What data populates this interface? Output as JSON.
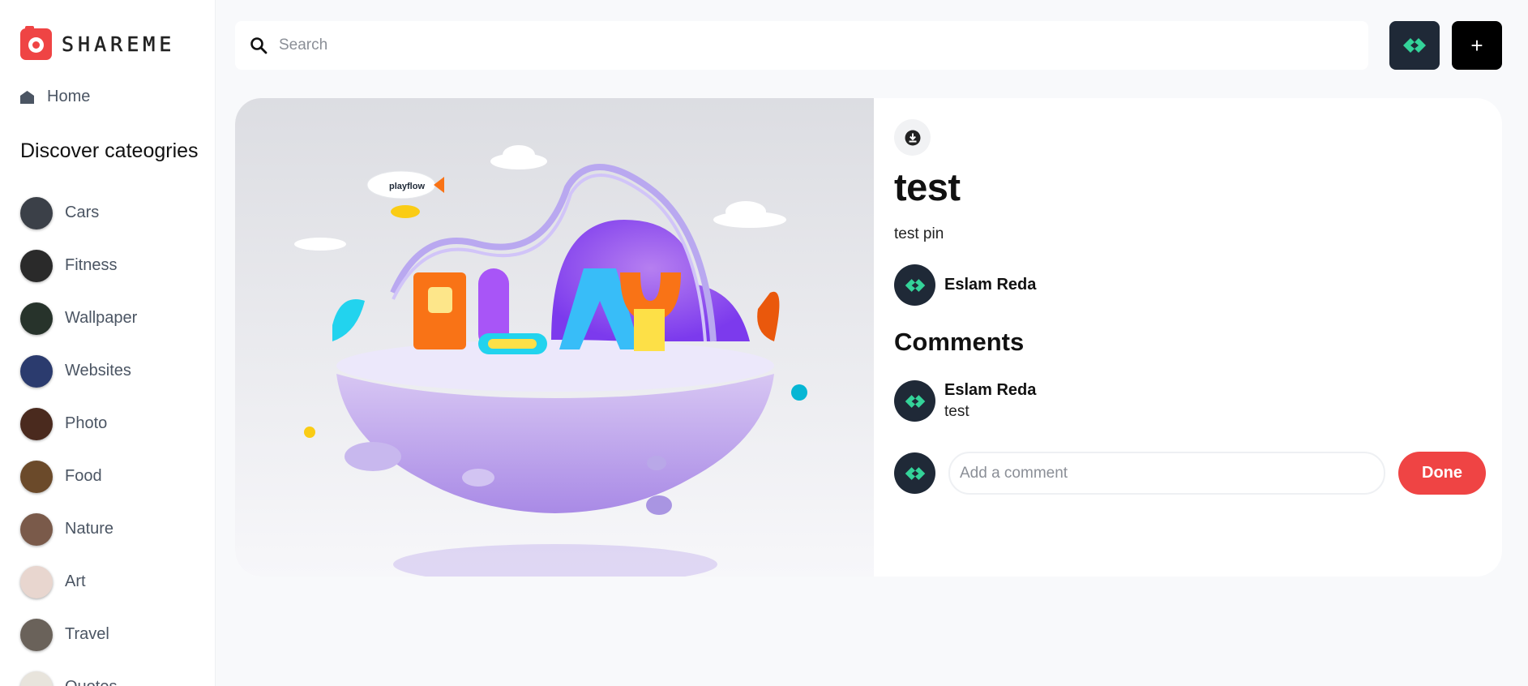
{
  "brand": {
    "name": "SHAREME",
    "accent": "#ef4444"
  },
  "sidebar": {
    "home_label": "Home",
    "discover_heading": "Discover cateogries",
    "categories": [
      {
        "label": "Cars",
        "color": "#3b4048"
      },
      {
        "label": "Fitness",
        "color": "#2a2a2a"
      },
      {
        "label": "Wallpaper",
        "color": "#27332b"
      },
      {
        "label": "Websites",
        "color": "#2b3b6e"
      },
      {
        "label": "Photo",
        "color": "#4a2a1e"
      },
      {
        "label": "Food",
        "color": "#6b4a2a"
      },
      {
        "label": "Nature",
        "color": "#7a5a4a"
      },
      {
        "label": "Art",
        "color": "#e8d6cf"
      },
      {
        "label": "Travel",
        "color": "#6a625a"
      },
      {
        "label": "Quotes",
        "color": "#e8e4dc"
      }
    ]
  },
  "topbar": {
    "search_placeholder": "Search",
    "add_label": "+"
  },
  "pin": {
    "title": "test",
    "about": "test pin",
    "author": "Eslam Reda",
    "image_alt": "playflow"
  },
  "comments": {
    "heading": "Comments",
    "items": [
      {
        "user": "Eslam Reda",
        "text": "test"
      }
    ],
    "input_placeholder": "Add a comment",
    "done_label": "Done"
  }
}
